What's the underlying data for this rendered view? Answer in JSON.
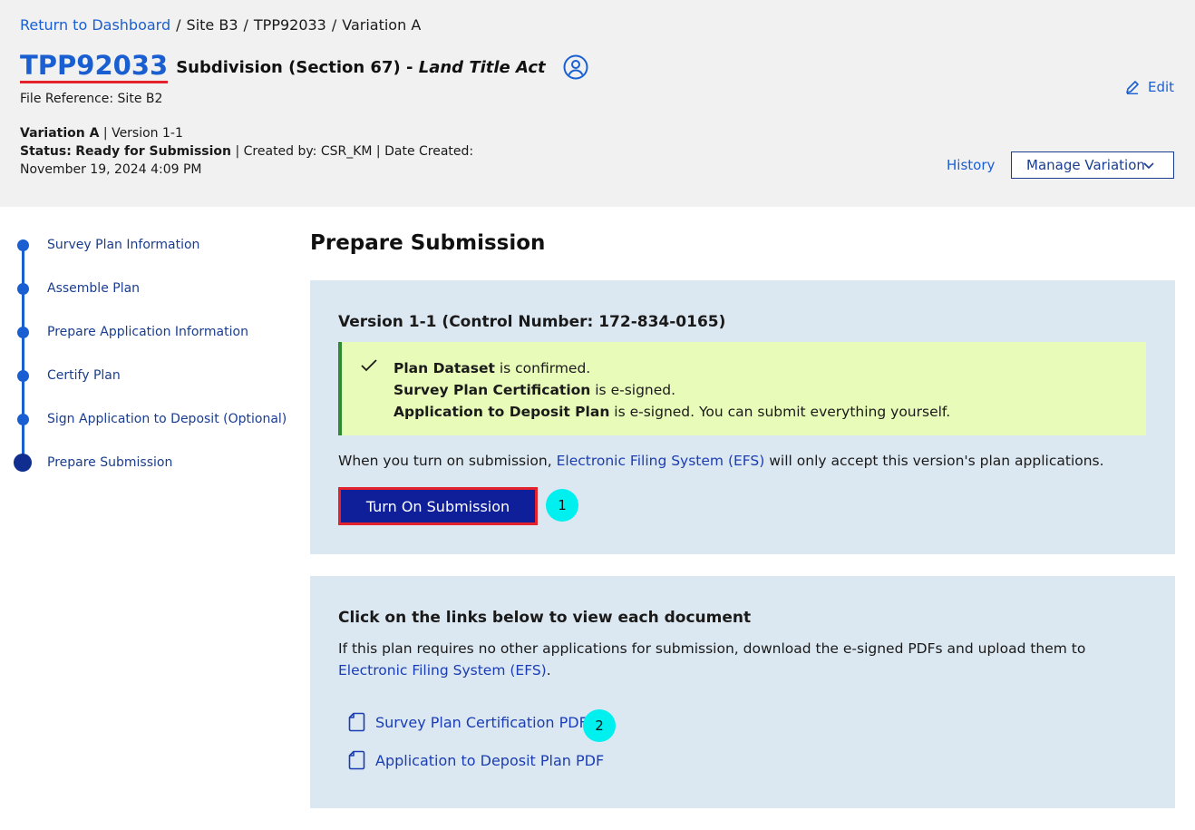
{
  "breadcrumb": {
    "dashboard": "Return to Dashboard",
    "site": "Site B3",
    "plan": "TPP92033",
    "variation": "Variation A",
    "separator": "/"
  },
  "header": {
    "plan_id": "TPP92033",
    "plan_type": "Subdivision (Section 67) -",
    "act": "Land Title Act",
    "user_icon": "user-circle-icon",
    "file_ref_label": "File Reference:",
    "file_ref_value": "Site B2",
    "variation_label": "Variation A",
    "version_text": "| Version 1-1",
    "status_label": "Status:",
    "status_value": "Ready for Submission",
    "created_text": "| Created by: CSR_KM | Date Created: November 19, 2024 4:09 PM",
    "edit_label": "Edit",
    "history_label": "History",
    "manage_label": "Manage Variation"
  },
  "stepper": {
    "steps": [
      "Survey Plan Information",
      "Assemble Plan",
      "Prepare Application Information",
      "Certify Plan",
      "Sign Application to Deposit (Optional)",
      "Prepare Submission"
    ],
    "active_index": 5
  },
  "main": {
    "title": "Prepare Submission",
    "version_title": "Version 1-1 (Control Number: 172-834-0165)",
    "success": [
      {
        "bold": "Plan Dataset",
        "rest": " is confirmed."
      },
      {
        "bold": "Survey Plan Certification",
        "rest": " is e-signed."
      },
      {
        "bold": "Application to Deposit Plan",
        "rest": " is e-signed. You can submit everything yourself."
      }
    ],
    "efs_note_before": "When you turn on submission, ",
    "efs_link": "Electronic Filing System (EFS)",
    "efs_note_after": " will only accept this version's plan applications.",
    "turn_on_label": "Turn On Submission",
    "marker1": "1",
    "docs_title": "Click on the links below to view each document",
    "docs_intro_before": "If this plan requires no other applications for submission, download the e-signed PDFs and upload them to ",
    "docs_intro_link": "Electronic Filing System (EFS)",
    "docs_intro_after": ".",
    "doc_links": [
      "Survey Plan Certification PDF",
      "Application to Deposit Plan PDF"
    ],
    "marker2": "2"
  },
  "colors": {
    "link": "#1a5fd1",
    "primary_button": "#0f1f9a",
    "success_bg": "#e8fbb9",
    "panel_bg": "#dce8f1",
    "marker": "#00f0f0"
  }
}
